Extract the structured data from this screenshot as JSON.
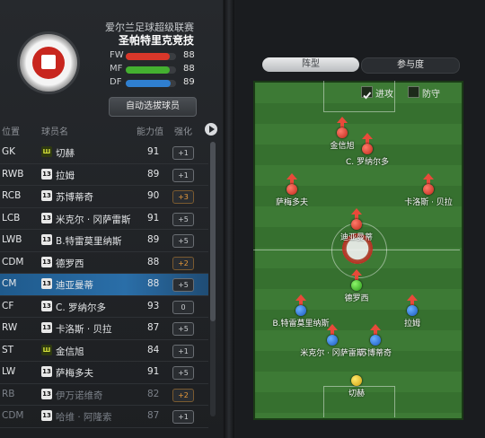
{
  "club": {
    "league": "爱尔兰足球超级联赛",
    "team": "圣帕特里克竞技"
  },
  "ratings": [
    {
      "label": "FW",
      "value": 88,
      "color": "#d9372a",
      "fill": 0.88
    },
    {
      "label": "MF",
      "value": 88,
      "color": "#44b030",
      "fill": 0.88
    },
    {
      "label": "DF",
      "value": 89,
      "color": "#2f7fd0",
      "fill": 0.89
    }
  ],
  "auto_button": "自动选拔球员",
  "table": {
    "headers": {
      "pos": "位置",
      "name": "球员名",
      "rating": "能力值",
      "upgrade": "强化"
    },
    "rows": [
      {
        "pos": "GK",
        "badge": "W",
        "name": "切赫",
        "rating": "91",
        "upg": "+1"
      },
      {
        "pos": "RWB",
        "badge": "13",
        "name": "拉姆",
        "rating": "89",
        "upg": "+1"
      },
      {
        "pos": "RCB",
        "badge": "13",
        "name": "苏博蒂奇",
        "rating": "90",
        "upg": "+3"
      },
      {
        "pos": "LCB",
        "badge": "13",
        "name": "米克尔 · 冈萨雷斯",
        "rating": "91",
        "upg": "+5"
      },
      {
        "pos": "LWB",
        "badge": "13",
        "name": "B.特雷莫里纳斯",
        "rating": "89",
        "upg": "+5"
      },
      {
        "pos": "CDM",
        "badge": "13",
        "name": "德罗西",
        "rating": "88",
        "upg": "+2"
      },
      {
        "pos": "CM",
        "badge": "13",
        "name": "迪亚曼蒂",
        "rating": "88",
        "upg": "+5"
      },
      {
        "pos": "CF",
        "badge": "13",
        "name": "C. 罗纳尔多",
        "rating": "93",
        "upg": "0"
      },
      {
        "pos": "RW",
        "badge": "13",
        "name": "卡洛斯 · 贝拉",
        "rating": "87",
        "upg": "+5"
      },
      {
        "pos": "ST",
        "badge": "W",
        "name": "金信旭",
        "rating": "84",
        "upg": "+1"
      },
      {
        "pos": "LW",
        "badge": "13",
        "name": "萨梅多夫",
        "rating": "91",
        "upg": "+5"
      },
      {
        "pos": "RB",
        "badge": "13",
        "name": "伊万诺维奇",
        "rating": "82",
        "upg": "+2"
      },
      {
        "pos": "CDM",
        "badge": "13",
        "name": "哈维 · 阿隆索",
        "rating": "87",
        "upg": "+1"
      }
    ]
  },
  "tabs": {
    "formation": "阵型",
    "participation": "参与度"
  },
  "pitch": {
    "attack_label": "进攻",
    "defend_label": "防守",
    "players": [
      {
        "name": "金信旭",
        "color": "red",
        "arrow": true
      },
      {
        "name": "C. 罗纳尔多",
        "color": "red",
        "arrow": true
      },
      {
        "name": "萨梅多夫",
        "color": "red",
        "arrow": true
      },
      {
        "name": "卡洛斯 · 贝拉",
        "color": "red",
        "arrow": true
      },
      {
        "name": "迪亚曼蒂",
        "color": "red",
        "arrow": true
      },
      {
        "name": "德罗西",
        "color": "green",
        "arrow": true
      },
      {
        "name": "B.特雷莫里纳斯",
        "color": "blue",
        "arrow": true
      },
      {
        "name": "拉姆",
        "color": "blue",
        "arrow": true
      },
      {
        "name": "米克尔 · 冈萨雷斯",
        "color": "blue",
        "arrow": true
      },
      {
        "name": "苏博蒂奇",
        "color": "blue",
        "arrow": true
      },
      {
        "name": "切赫",
        "color": "yellow",
        "arrow": false
      }
    ]
  }
}
